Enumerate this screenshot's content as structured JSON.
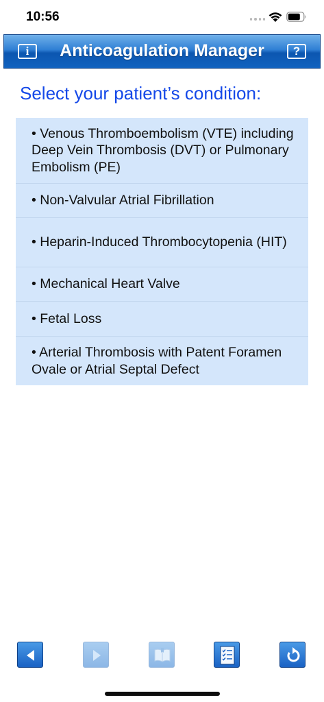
{
  "status_bar": {
    "time": "10:56",
    "icons": [
      "signal-icon",
      "wifi-icon",
      "battery-icon"
    ]
  },
  "header": {
    "title": "Anticoagulation Manager",
    "info_label": "i",
    "help_label": "?"
  },
  "main": {
    "heading": "Select your patient’s condition:",
    "conditions": [
      "• Venous Thromboembolism (VTE) including Deep Vein Thrombosis (DVT) or Pulmonary Embolism (PE)",
      "• Non-Valvular Atrial Fibrillation",
      "• Heparin-Induced Thrombocytopenia (HIT)",
      "• Mechanical Heart Valve",
      "• Fetal Loss",
      "• Arterial Thrombosis with Patent Foramen Ovale or Atrial Septal Defect"
    ]
  },
  "toolbar": {
    "buttons": [
      {
        "name": "back",
        "icon": "arrow-left-icon",
        "enabled": true
      },
      {
        "name": "forward",
        "icon": "arrow-right-icon",
        "enabled": false
      },
      {
        "name": "book",
        "icon": "book-icon",
        "enabled": false
      },
      {
        "name": "checklist",
        "icon": "checklist-icon",
        "enabled": true
      },
      {
        "name": "restart",
        "icon": "restart-icon",
        "enabled": true
      }
    ]
  },
  "colors": {
    "heading": "#1448e8",
    "list_background": "#d4e6fb",
    "title_bar": "#1162bf"
  }
}
